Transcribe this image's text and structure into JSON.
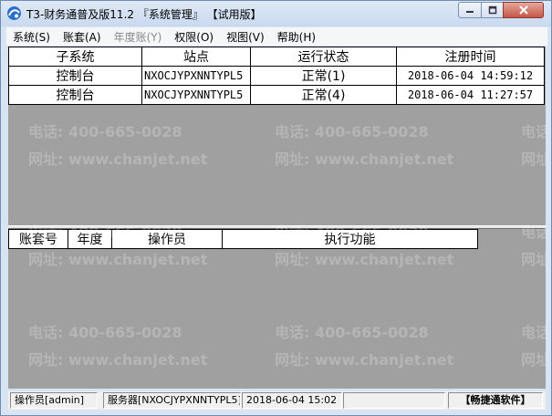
{
  "window": {
    "title": "T3-财务通普及版11.2 『系统管理』 【试用版】",
    "controls": {
      "minimize": "minimize",
      "maximize": "maximize",
      "close": "close"
    }
  },
  "menubar": {
    "items": [
      {
        "label": "系统(S)",
        "enabled": true
      },
      {
        "label": "账套(A)",
        "enabled": true
      },
      {
        "label": "年度账(Y)",
        "enabled": false
      },
      {
        "label": "权限(O)",
        "enabled": true
      },
      {
        "label": "视图(V)",
        "enabled": true
      },
      {
        "label": "帮助(H)",
        "enabled": true
      }
    ]
  },
  "sessions": {
    "columns": [
      "子系统",
      "站点",
      "运行状态",
      "注册时间"
    ],
    "rows": [
      [
        "控制台",
        "NXOCJYPXNNTYPL5",
        "正常(1)",
        "2018-06-04 14:59:12"
      ],
      [
        "控制台",
        "NXOCJYPXNNTYPL5",
        "正常(4)",
        "2018-06-04 11:27:57"
      ]
    ]
  },
  "tasks": {
    "columns": [
      "账套号",
      "年度",
      "操作员",
      "执行功能"
    ]
  },
  "watermark": {
    "phone": "电话: 400-665-0028",
    "site": "网址: www.chanjet.net"
  },
  "statusbar": {
    "operator": "操作员[admin]",
    "server": "服务器[NXOCJYPXNNTYPL5]",
    "datetime": "2018-06-04 15:02",
    "empty": "",
    "brand": "【畅捷通软件】"
  },
  "colors": {
    "client_bg": "#a0a0a0",
    "title_bg": "#dfe9f6",
    "close_btn": "#c7574a"
  }
}
